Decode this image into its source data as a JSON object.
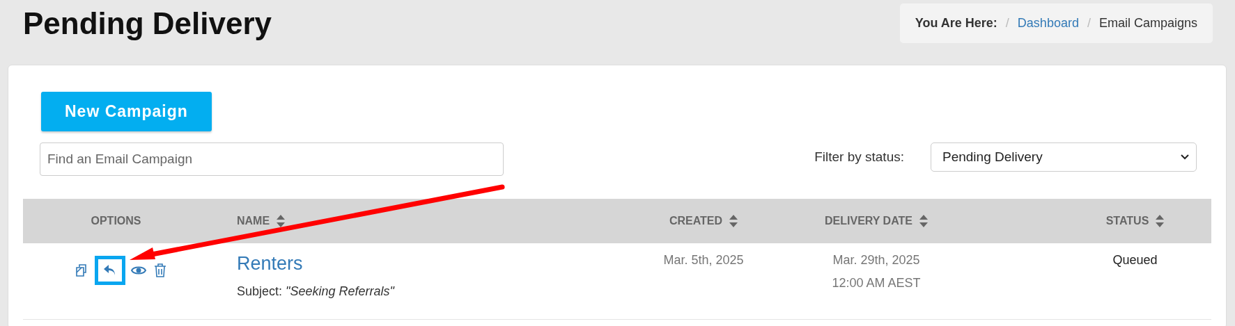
{
  "page": {
    "title": "Pending Delivery"
  },
  "breadcrumb": {
    "label": "You Are Here:",
    "separator": "/",
    "items": [
      {
        "text": "Dashboard",
        "link": true
      },
      {
        "text": "Email Campaigns",
        "link": false
      }
    ]
  },
  "toolbar": {
    "new_button": "New Campaign",
    "search": {
      "placeholder": "Find an Email Campaign"
    },
    "filter": {
      "label": "Filter by status:",
      "value": "Pending Delivery"
    }
  },
  "table": {
    "columns": [
      {
        "label": "OPTIONS",
        "sortable": false
      },
      {
        "label": "NAME",
        "sortable": true
      },
      {
        "label": "CREATED",
        "sortable": true
      },
      {
        "label": "DELIVERY DATE",
        "sortable": true
      },
      {
        "label": "STATUS",
        "sortable": true
      }
    ],
    "rows": [
      {
        "options": [
          {
            "kind": "copy",
            "highlighted": false
          },
          {
            "kind": "reply",
            "highlighted": true
          },
          {
            "kind": "view",
            "highlighted": false
          },
          {
            "kind": "delete",
            "highlighted": false
          }
        ],
        "name": "Renters",
        "subject_label": "Subject:",
        "subject": "\"Seeking Referrals\"",
        "created": "Mar. 5th, 2025",
        "delivery_date": "Mar. 29th, 2025",
        "delivery_time": "12:00 AM AEST",
        "status": "Queued"
      }
    ]
  }
}
